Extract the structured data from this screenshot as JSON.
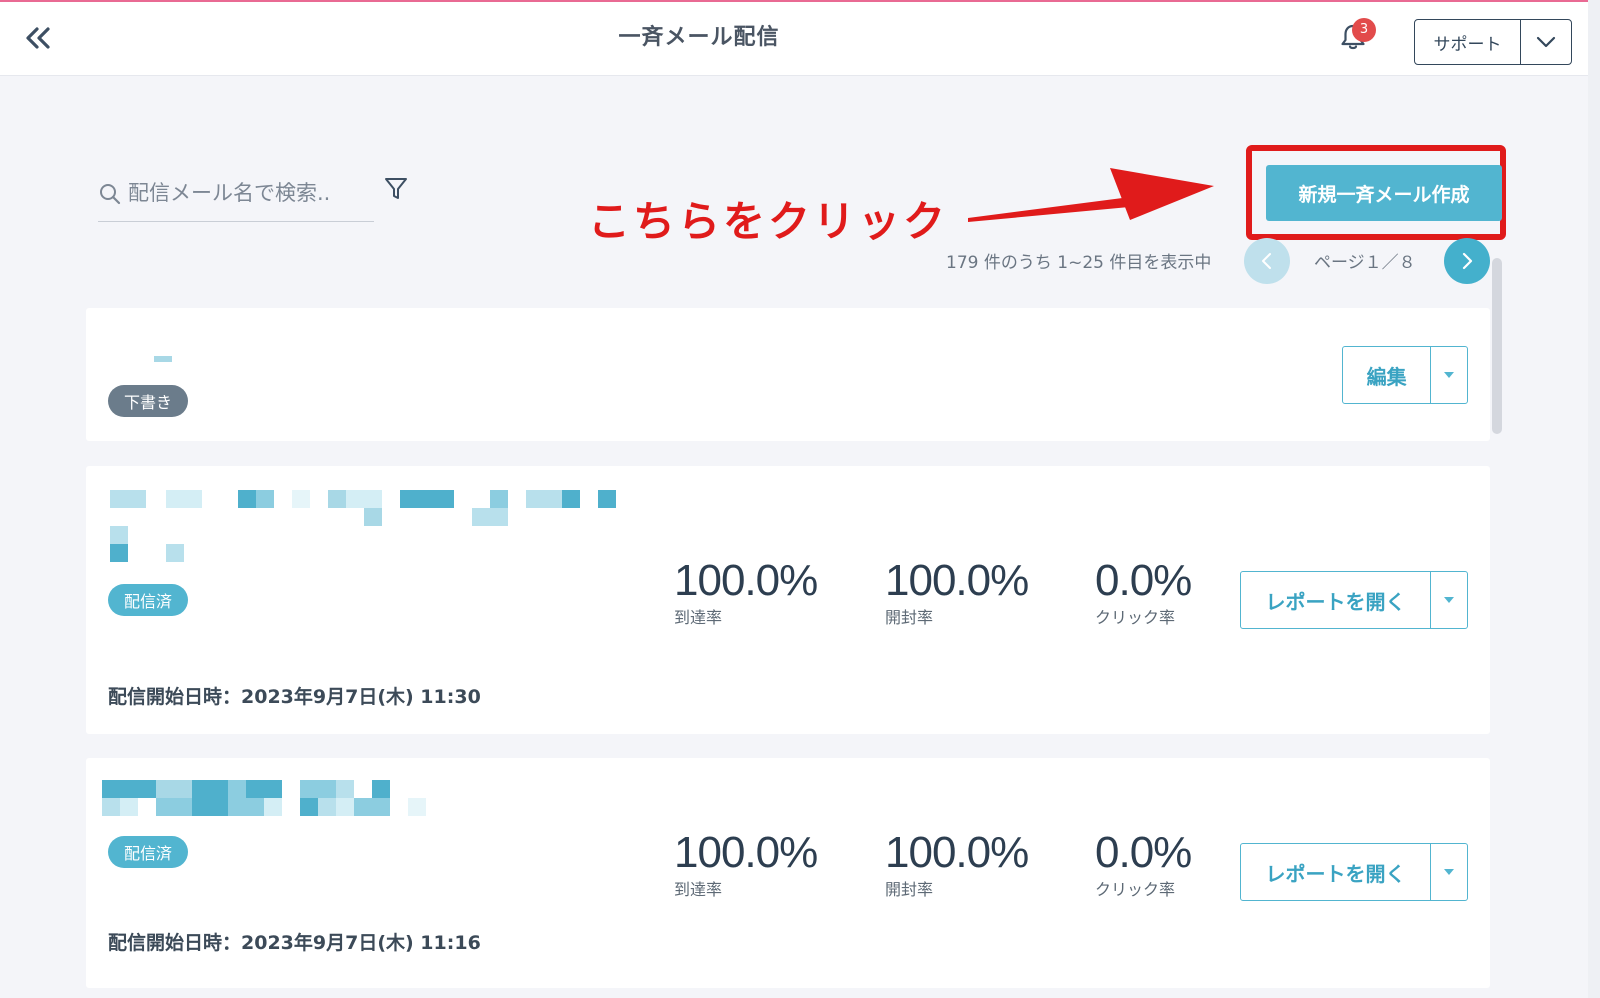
{
  "header": {
    "title": "一斉メール配信",
    "notification_count": "3",
    "support_label": "サポート"
  },
  "search": {
    "placeholder": "配信メール名で検索.."
  },
  "annotation": {
    "text": "こちらをクリック",
    "color": "#e01b1b"
  },
  "toolbar": {
    "create_label": "新規一斉メール作成"
  },
  "pagination": {
    "summary": "179 件のうち 1~25 件目を表示中",
    "page_label": "ページ１／８"
  },
  "emails": [
    {
      "status": "下書き",
      "action_label": "編集"
    },
    {
      "status": "配信済",
      "stats": [
        {
          "value": "100.0%",
          "label": "到達率"
        },
        {
          "value": "100.0%",
          "label": "開封率"
        },
        {
          "value": "0.0%",
          "label": "クリック率"
        }
      ],
      "action_label": "レポートを開く",
      "sent_at": "配信開始日時：2023年9月7日(木) 11:30"
    },
    {
      "status": "配信済",
      "stats": [
        {
          "value": "100.0%",
          "label": "到達率"
        },
        {
          "value": "100.0%",
          "label": "開封率"
        },
        {
          "value": "0.0%",
          "label": "クリック率"
        }
      ],
      "action_label": "レポートを開く",
      "sent_at": "配信開始日時：2023年9月7日(木) 11:16"
    }
  ],
  "colors": {
    "accent": "#52b5d0",
    "draft_tag": "#6b7c8b",
    "badge": "#e24b4b"
  }
}
